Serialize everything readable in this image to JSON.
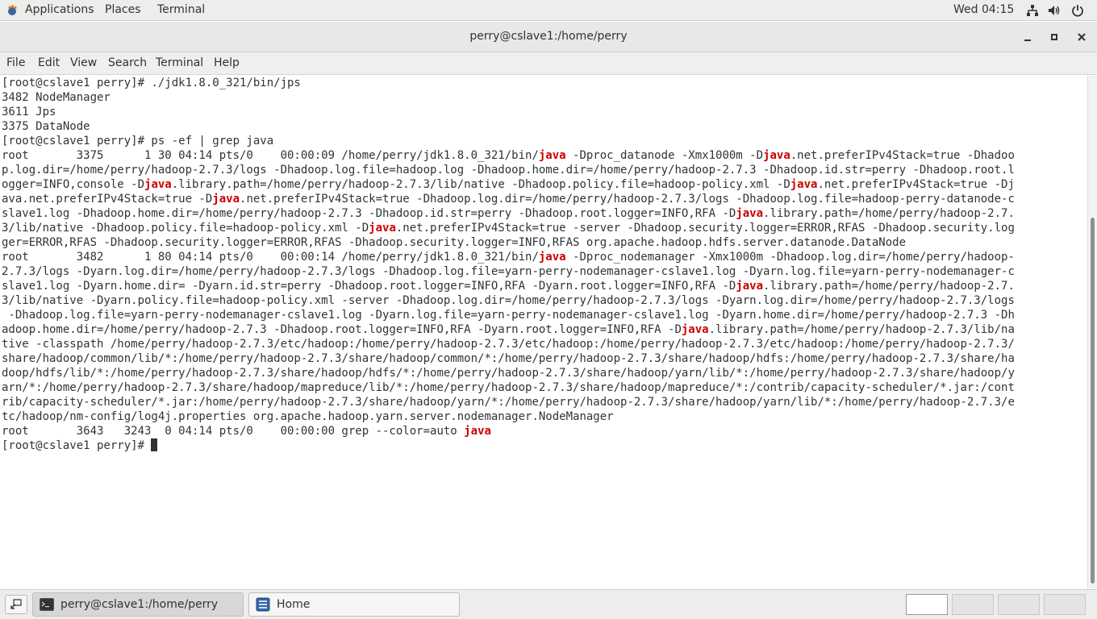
{
  "top_panel": {
    "applications": "Applications",
    "places": "Places",
    "terminal": "Terminal",
    "clock": "Wed 04:15",
    "tray_icons": [
      "network-icon",
      "volume-icon",
      "power-icon"
    ]
  },
  "window": {
    "title": "perry@cslave1:/home/perry"
  },
  "menubar": {
    "items": [
      "File",
      "Edit",
      "View",
      "Search",
      "Terminal",
      "Help"
    ]
  },
  "terminal": {
    "lines": [
      "[root@cslave1 perry]# ./jdk1.8.0_321/bin/jps",
      "3482 NodeManager",
      "3611 Jps",
      "3375 DataNode",
      "[root@cslave1 perry]# ps -ef | grep java",
      "root       3375      1 30 04:14 pts/0    00:00:09 /home/perry/jdk1.8.0_321/bin/java -Dproc_datanode -Xmx1000m -Djava.net.preferIPv4Stack=true -Dhadoo",
      "p.log.dir=/home/perry/hadoop-2.7.3/logs -Dhadoop.log.file=hadoop.log -Dhadoop.home.dir=/home/perry/hadoop-2.7.3 -Dhadoop.id.str=perry -Dhadoop.root.l",
      "ogger=INFO,console -Djava.library.path=/home/perry/hadoop-2.7.3/lib/native -Dhadoop.policy.file=hadoop-policy.xml -Djava.net.preferIPv4Stack=true -Dj",
      "ava.net.preferIPv4Stack=true -Djava.net.preferIPv4Stack=true -Dhadoop.log.dir=/home/perry/hadoop-2.7.3/logs -Dhadoop.log.file=hadoop-perry-datanode-c",
      "slave1.log -Dhadoop.home.dir=/home/perry/hadoop-2.7.3 -Dhadoop.id.str=perry -Dhadoop.root.logger=INFO,RFA -Djava.library.path=/home/perry/hadoop-2.7.",
      "3/lib/native -Dhadoop.policy.file=hadoop-policy.xml -Djava.net.preferIPv4Stack=true -server -Dhadoop.security.logger=ERROR,RFAS -Dhadoop.security.log",
      "ger=ERROR,RFAS -Dhadoop.security.logger=ERROR,RFAS -Dhadoop.security.logger=INFO,RFAS org.apache.hadoop.hdfs.server.datanode.DataNode",
      "root       3482      1 80 04:14 pts/0    00:00:14 /home/perry/jdk1.8.0_321/bin/java -Dproc_nodemanager -Xmx1000m -Dhadoop.log.dir=/home/perry/hadoop-",
      "2.7.3/logs -Dyarn.log.dir=/home/perry/hadoop-2.7.3/logs -Dhadoop.log.file=yarn-perry-nodemanager-cslave1.log -Dyarn.log.file=yarn-perry-nodemanager-c",
      "slave1.log -Dyarn.home.dir= -Dyarn.id.str=perry -Dhadoop.root.logger=INFO,RFA -Dyarn.root.logger=INFO,RFA -Djava.library.path=/home/perry/hadoop-2.7.",
      "3/lib/native -Dyarn.policy.file=hadoop-policy.xml -server -Dhadoop.log.dir=/home/perry/hadoop-2.7.3/logs -Dyarn.log.dir=/home/perry/hadoop-2.7.3/logs",
      " -Dhadoop.log.file=yarn-perry-nodemanager-cslave1.log -Dyarn.log.file=yarn-perry-nodemanager-cslave1.log -Dyarn.home.dir=/home/perry/hadoop-2.7.3 -Dh",
      "adoop.home.dir=/home/perry/hadoop-2.7.3 -Dhadoop.root.logger=INFO,RFA -Dyarn.root.logger=INFO,RFA -Djava.library.path=/home/perry/hadoop-2.7.3/lib/na",
      "tive -classpath /home/perry/hadoop-2.7.3/etc/hadoop:/home/perry/hadoop-2.7.3/etc/hadoop:/home/perry/hadoop-2.7.3/etc/hadoop:/home/perry/hadoop-2.7.3/",
      "share/hadoop/common/lib/*:/home/perry/hadoop-2.7.3/share/hadoop/common/*:/home/perry/hadoop-2.7.3/share/hadoop/hdfs:/home/perry/hadoop-2.7.3/share/ha",
      "doop/hdfs/lib/*:/home/perry/hadoop-2.7.3/share/hadoop/hdfs/*:/home/perry/hadoop-2.7.3/share/hadoop/yarn/lib/*:/home/perry/hadoop-2.7.3/share/hadoop/y",
      "arn/*:/home/perry/hadoop-2.7.3/share/hadoop/mapreduce/lib/*:/home/perry/hadoop-2.7.3/share/hadoop/mapreduce/*:/contrib/capacity-scheduler/*.jar:/cont",
      "rib/capacity-scheduler/*.jar:/home/perry/hadoop-2.7.3/share/hadoop/yarn/*:/home/perry/hadoop-2.7.3/share/hadoop/yarn/lib/*:/home/perry/hadoop-2.7.3/e",
      "tc/hadoop/nm-config/log4j.properties org.apache.hadoop.yarn.server.nodemanager.NodeManager",
      "root       3643   3243  0 04:14 pts/0    00:00:00 grep --color=auto java",
      "[root@cslave1 perry]# "
    ],
    "highlight": "java",
    "colors": {
      "highlight": "#cc0000",
      "text": "#2e3436"
    }
  },
  "taskbar": {
    "tasks": [
      {
        "label": "perry@cslave1:/home/perry",
        "icon": "terminal-icon",
        "active": true
      },
      {
        "label": "Home",
        "icon": "file-manager-icon",
        "active": false
      }
    ],
    "workspaces": [
      {
        "active": true
      },
      {
        "active": false
      },
      {
        "active": false
      },
      {
        "active": false
      }
    ]
  }
}
